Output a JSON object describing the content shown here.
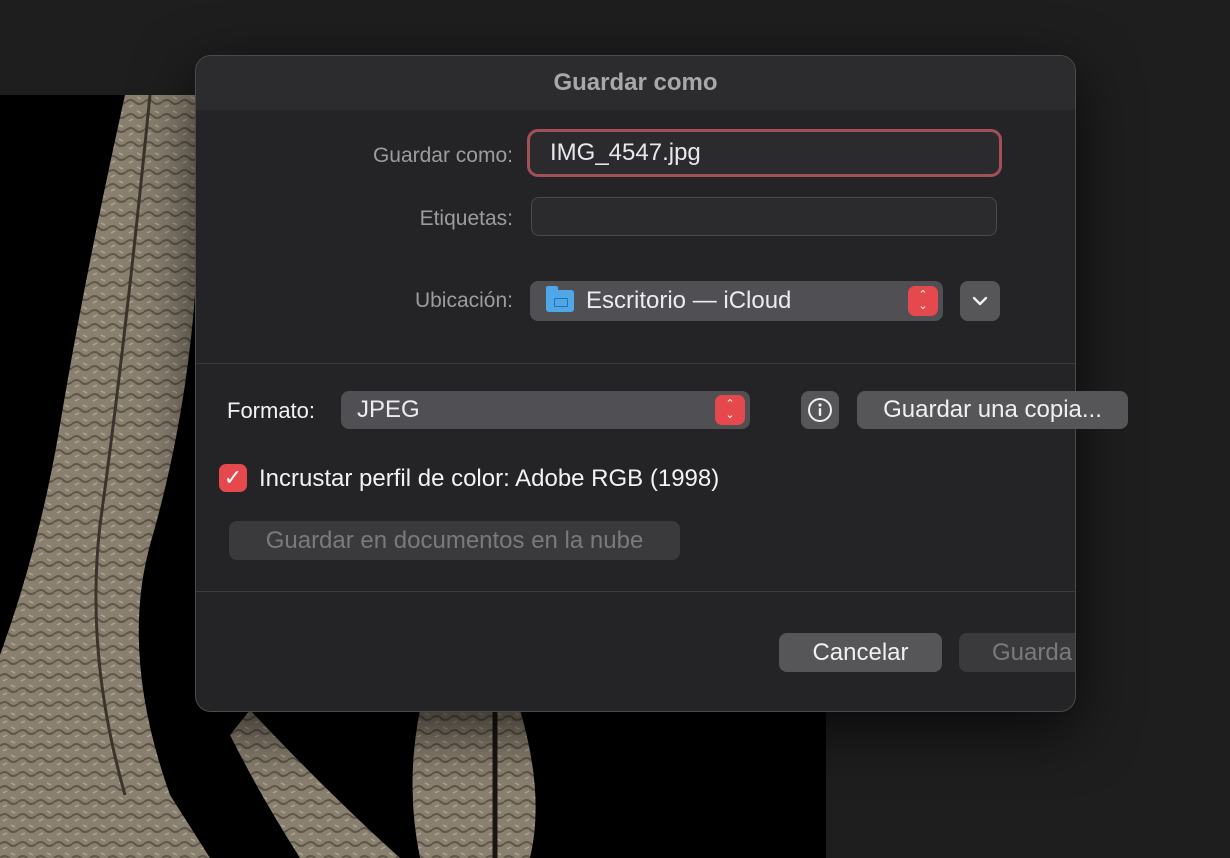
{
  "dialog": {
    "title": "Guardar como",
    "save_as_label": "Guardar como:",
    "filename_value": "IMG_4547.jpg",
    "tags_label": "Etiquetas:",
    "tags_value": "",
    "location_label": "Ubicación:",
    "location_value": "Escritorio — iCloud",
    "format_label": "Formato:",
    "format_value": "JPEG",
    "save_copy_label": "Guardar una copia...",
    "embed_profile_label": "Incrustar perfil de color: Adobe RGB (1998)",
    "embed_profile_checked": true,
    "cloud_docs_label": "Guardar en documentos en la nube",
    "cancel_label": "Cancelar",
    "save_label": "Guarda"
  },
  "colors": {
    "accent": "#e5484d",
    "focus_ring": "#a24f58"
  },
  "icons": {
    "folder": "folder-icon",
    "stepper": "up-down-chevron-icon",
    "expand": "chevron-down-icon",
    "info": "info-icon",
    "check": "checkmark-icon"
  }
}
